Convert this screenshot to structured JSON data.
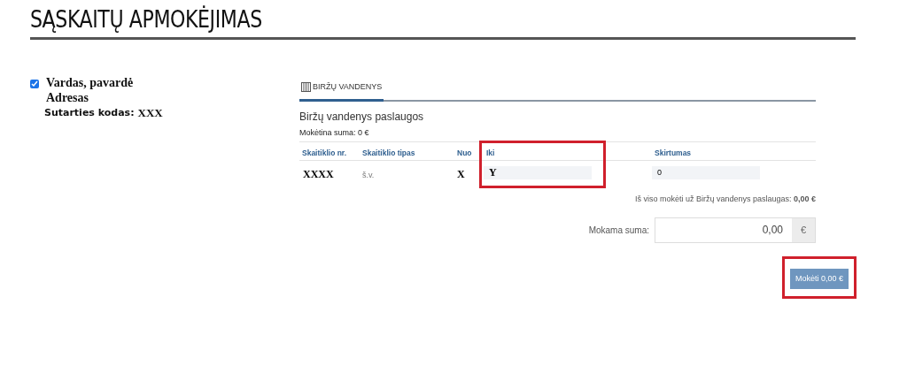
{
  "page_title": "SĄSKAITŲ APMOKĖJIMAS",
  "customer": {
    "checked": true,
    "name": "Vardas, pavardė",
    "address": "Adresas",
    "contract_label": "Sutarties kodas:",
    "contract_code": "XXX"
  },
  "tabs": [
    {
      "label": "BIRŽŲ VANDENYS",
      "selected": true
    }
  ],
  "service": {
    "title": "Biržų vandenys paslaugos",
    "amount_due": "Mokėtina suma: 0 €"
  },
  "table": {
    "columns": [
      "Skaitiklio nr.",
      "Skaitiklio tipas",
      "Nuo",
      "Iki",
      "Skirtumas"
    ],
    "rows": [
      {
        "meter_no": "XXXX",
        "meter_type": "š.v.",
        "from": "X",
        "to": "Y",
        "difference": "0"
      }
    ]
  },
  "total": "Iš viso mokėti už Biržų vandenys paslaugas: **0,00 €**",
  "payment": {
    "label": "Mokama suma:",
    "value": "0,00",
    "currency": "€"
  },
  "pay_button": "Mokėti 0,00 €"
}
